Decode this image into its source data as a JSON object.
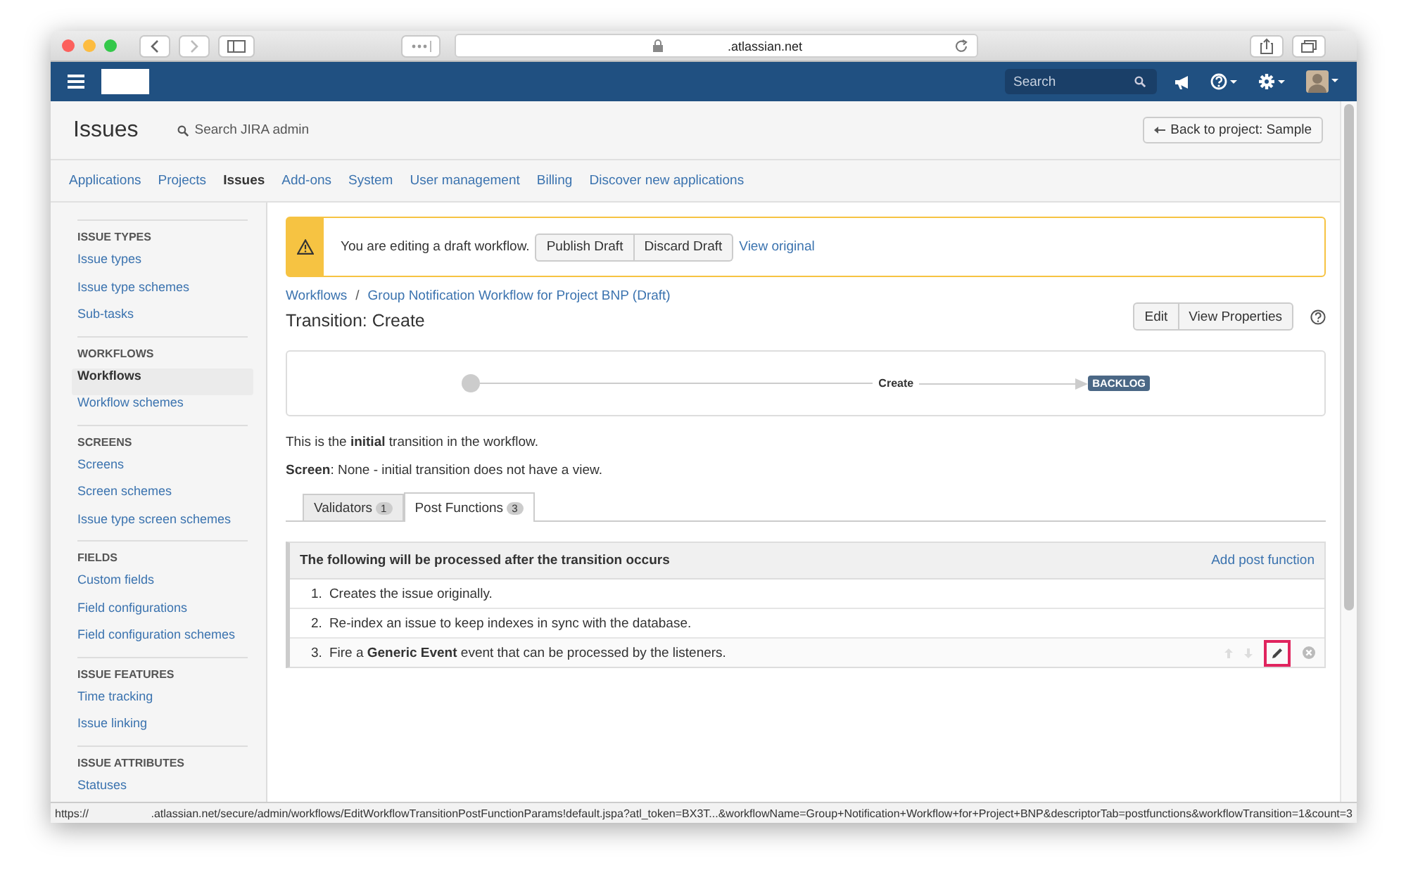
{
  "browser": {
    "url": ".atlassian.net",
    "status_prefix": "https://",
    "status_url": ".atlassian.net/secure/admin/workflows/EditWorkflowTransitionPostFunctionParams!default.jspa?atl_token=BX3T...&workflowName=Group+Notification+Workflow+for+Project+BNP&descriptorTab=postfunctions&workflowTransition=1&count=3"
  },
  "nav": {
    "search_placeholder": "Search"
  },
  "header": {
    "title": "Issues",
    "admin_search": "Search JIRA admin",
    "back_button": "Back to project: Sample"
  },
  "admin_tabs": [
    {
      "label": "Applications",
      "selected": false
    },
    {
      "label": "Projects",
      "selected": false
    },
    {
      "label": "Issues",
      "selected": true
    },
    {
      "label": "Add-ons",
      "selected": false
    },
    {
      "label": "System",
      "selected": false
    },
    {
      "label": "User management",
      "selected": false
    },
    {
      "label": "Billing",
      "selected": false
    },
    {
      "label": "Discover new applications",
      "selected": false
    }
  ],
  "sidebar": {
    "sections": [
      {
        "heading": "ISSUE TYPES",
        "items": [
          {
            "label": "Issue types",
            "selected": false
          },
          {
            "label": "Issue type schemes",
            "selected": false
          },
          {
            "label": "Sub-tasks",
            "selected": false
          }
        ]
      },
      {
        "heading": "WORKFLOWS",
        "items": [
          {
            "label": "Workflows",
            "selected": true
          },
          {
            "label": "Workflow schemes",
            "selected": false
          }
        ]
      },
      {
        "heading": "SCREENS",
        "items": [
          {
            "label": "Screens",
            "selected": false
          },
          {
            "label": "Screen schemes",
            "selected": false
          },
          {
            "label": "Issue type screen schemes",
            "selected": false
          }
        ]
      },
      {
        "heading": "FIELDS",
        "items": [
          {
            "label": "Custom fields",
            "selected": false
          },
          {
            "label": "Field configurations",
            "selected": false
          },
          {
            "label": "Field configuration schemes",
            "selected": false
          }
        ]
      },
      {
        "heading": "ISSUE FEATURES",
        "items": [
          {
            "label": "Time tracking",
            "selected": false
          },
          {
            "label": "Issue linking",
            "selected": false
          }
        ]
      },
      {
        "heading": "ISSUE ATTRIBUTES",
        "items": [
          {
            "label": "Statuses",
            "selected": false
          }
        ]
      }
    ]
  },
  "draft_banner": {
    "message": "You are editing a draft workflow.",
    "buttons": [
      "Publish Draft",
      "Discard Draft"
    ],
    "link": "View original"
  },
  "breadcrumbs": [
    "Workflows",
    "Group Notification Workflow for Project BNP (Draft)"
  ],
  "breadcrumb_separator": "/",
  "transition_title": "Transition: Create",
  "actions": [
    "Edit",
    "View Properties"
  ],
  "diagram": {
    "transition": "Create",
    "status": "BACKLOG"
  },
  "description": "This is the **initial** transition in the workflow.",
  "screen_info": "**Screen**: None - initial transition does not have a view.",
  "tabs": [
    {
      "label": "Validators",
      "count": "1",
      "selected": false
    },
    {
      "label": "Post Functions",
      "count": "3",
      "selected": true
    }
  ],
  "post_functions": {
    "heading": "The following will be processed after the transition occurs",
    "add_link": "Add post function",
    "items": [
      {
        "number": "1.",
        "text": "Creates the issue originally.",
        "hovered": false,
        "edit_highlighted": false
      },
      {
        "number": "2.",
        "text": "Re-index an issue to keep indexes in sync with the database.",
        "hovered": false,
        "edit_highlighted": false
      },
      {
        "number": "3.",
        "text": "Fire a **Generic Event** event that can be processed by the listeners.",
        "hovered": true,
        "edit_highlighted": true
      }
    ]
  }
}
